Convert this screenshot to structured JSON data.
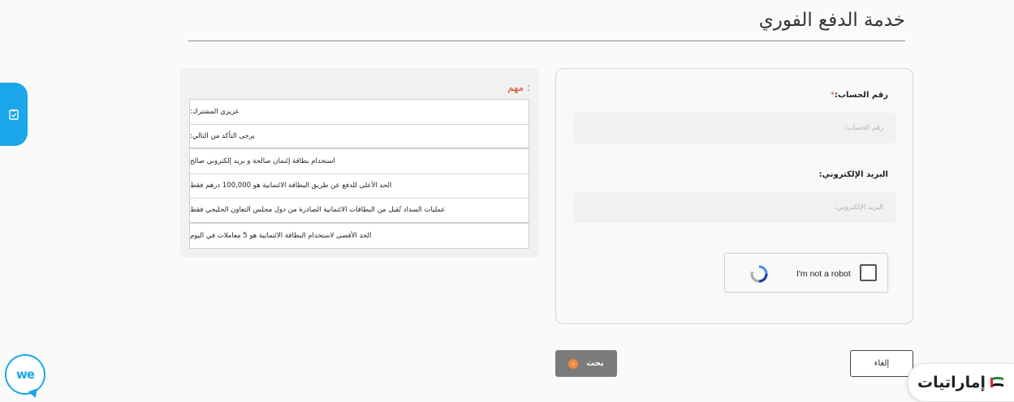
{
  "page": {
    "title": "خدمة الدفع الفوري"
  },
  "info": {
    "heading": "مهم :",
    "rows": [
      "عزيزي المشترك:",
      "يرجى التأكد من التالي:",
      "استخدام بطاقة إئتمان صالحة و بريد إلكتروني صالح",
      "الحد الأعلى للدفع عن طريق البطاقة الائتمانية هو 100,000 درهم فقط",
      "عمليات السداد تُقبل من البطاقات الائتمانية الصادرة من دول مجلس التعاون الخليجي فقط",
      "الحد الأقصى لاستخدام البطاقة الائتمانية هو 5 معاملات في اليوم"
    ]
  },
  "form": {
    "account_label": "رقم الحساب:",
    "account_required": "*",
    "account_placeholder": "رقم الحساب:",
    "email_label": "البريد الإلكتروني:",
    "email_placeholder": "البريد الإلكتروني:",
    "captcha_text": "I'm not a robot"
  },
  "buttons": {
    "search_label": "بحث",
    "cancel_label": "إلغاء"
  },
  "chat": {
    "label": "we"
  },
  "brand": {
    "name": "إماراتيات"
  },
  "colors": {
    "accent_blue": "#1aa6e8",
    "required_red": "#e0552f",
    "heading_red": "#d84a2a",
    "search_button": "#7b7b7b",
    "search_dot": "#f08a3e"
  }
}
